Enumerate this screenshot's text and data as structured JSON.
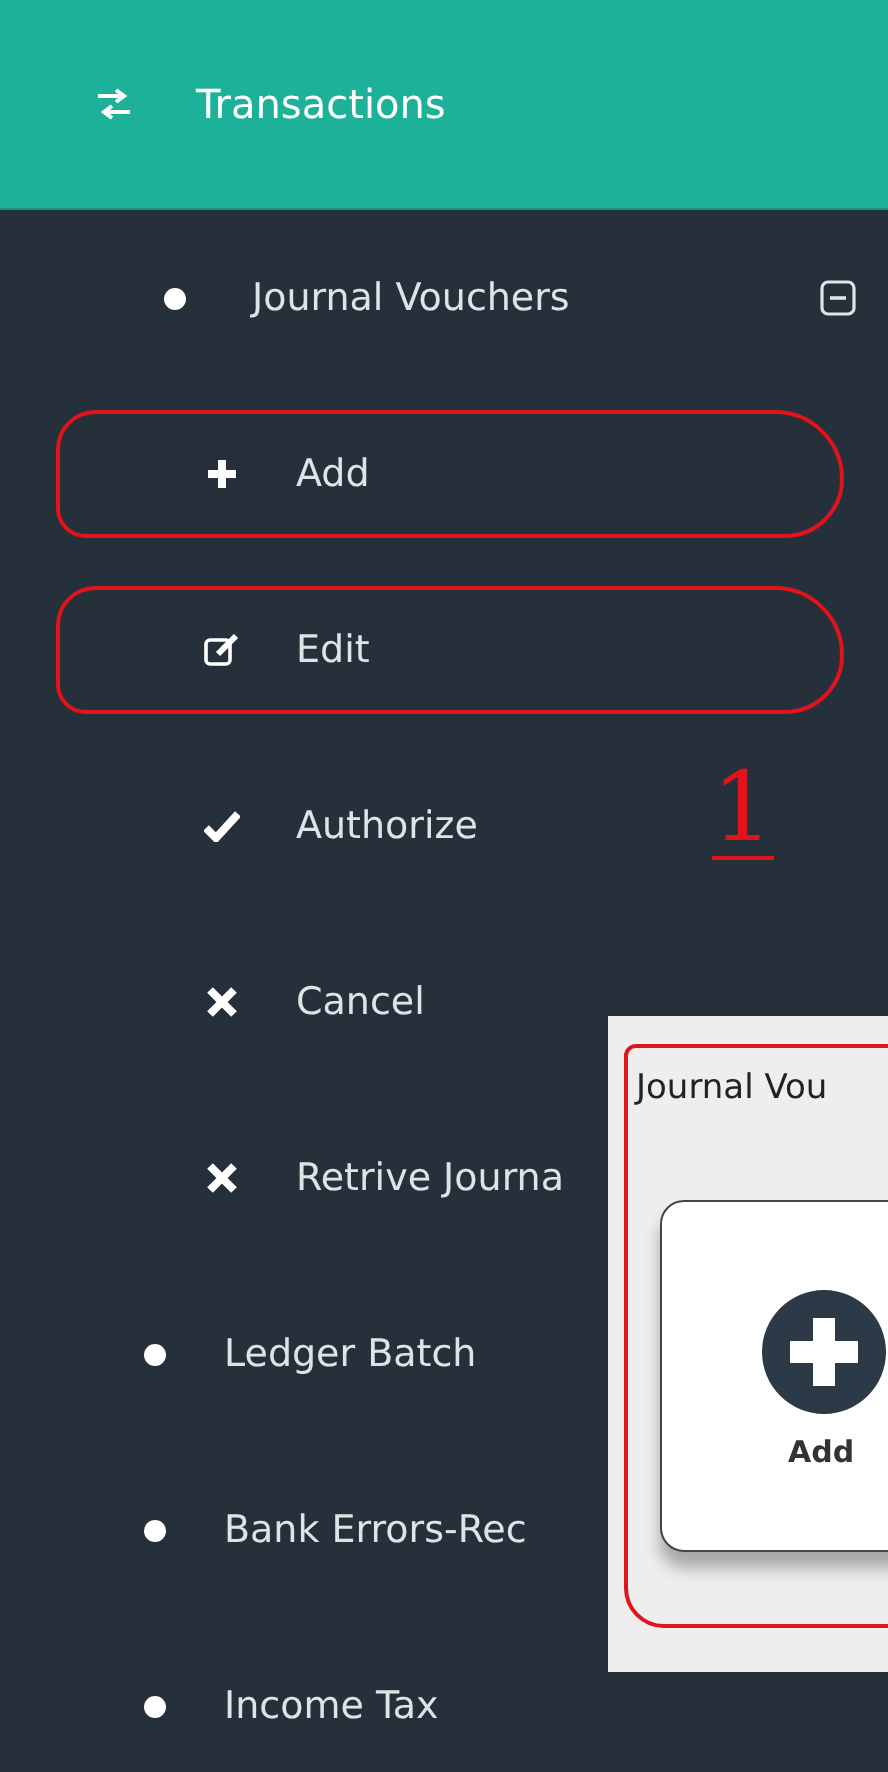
{
  "header": {
    "title": "Transactions"
  },
  "items": [
    {
      "label": "Journal Vouchers",
      "expanded": true,
      "children": [
        {
          "label": "Add",
          "kind": "plus",
          "highlighted": true
        },
        {
          "label": "Edit",
          "kind": "edit",
          "highlighted": true
        },
        {
          "label": "Authorize",
          "kind": "check",
          "highlighted": false
        },
        {
          "label": "Cancel",
          "kind": "cross",
          "highlighted": false
        },
        {
          "label": "Retrive Journa",
          "kind": "cross",
          "highlighted": false
        }
      ]
    },
    {
      "label": "Ledger Batch"
    },
    {
      "label": "Bank Errors-Rec"
    },
    {
      "label": "Income Tax"
    }
  ],
  "annotation": {
    "text": "1"
  },
  "inset": {
    "title": "Journal Vou",
    "card_label": "Add",
    "highlighted": true
  }
}
